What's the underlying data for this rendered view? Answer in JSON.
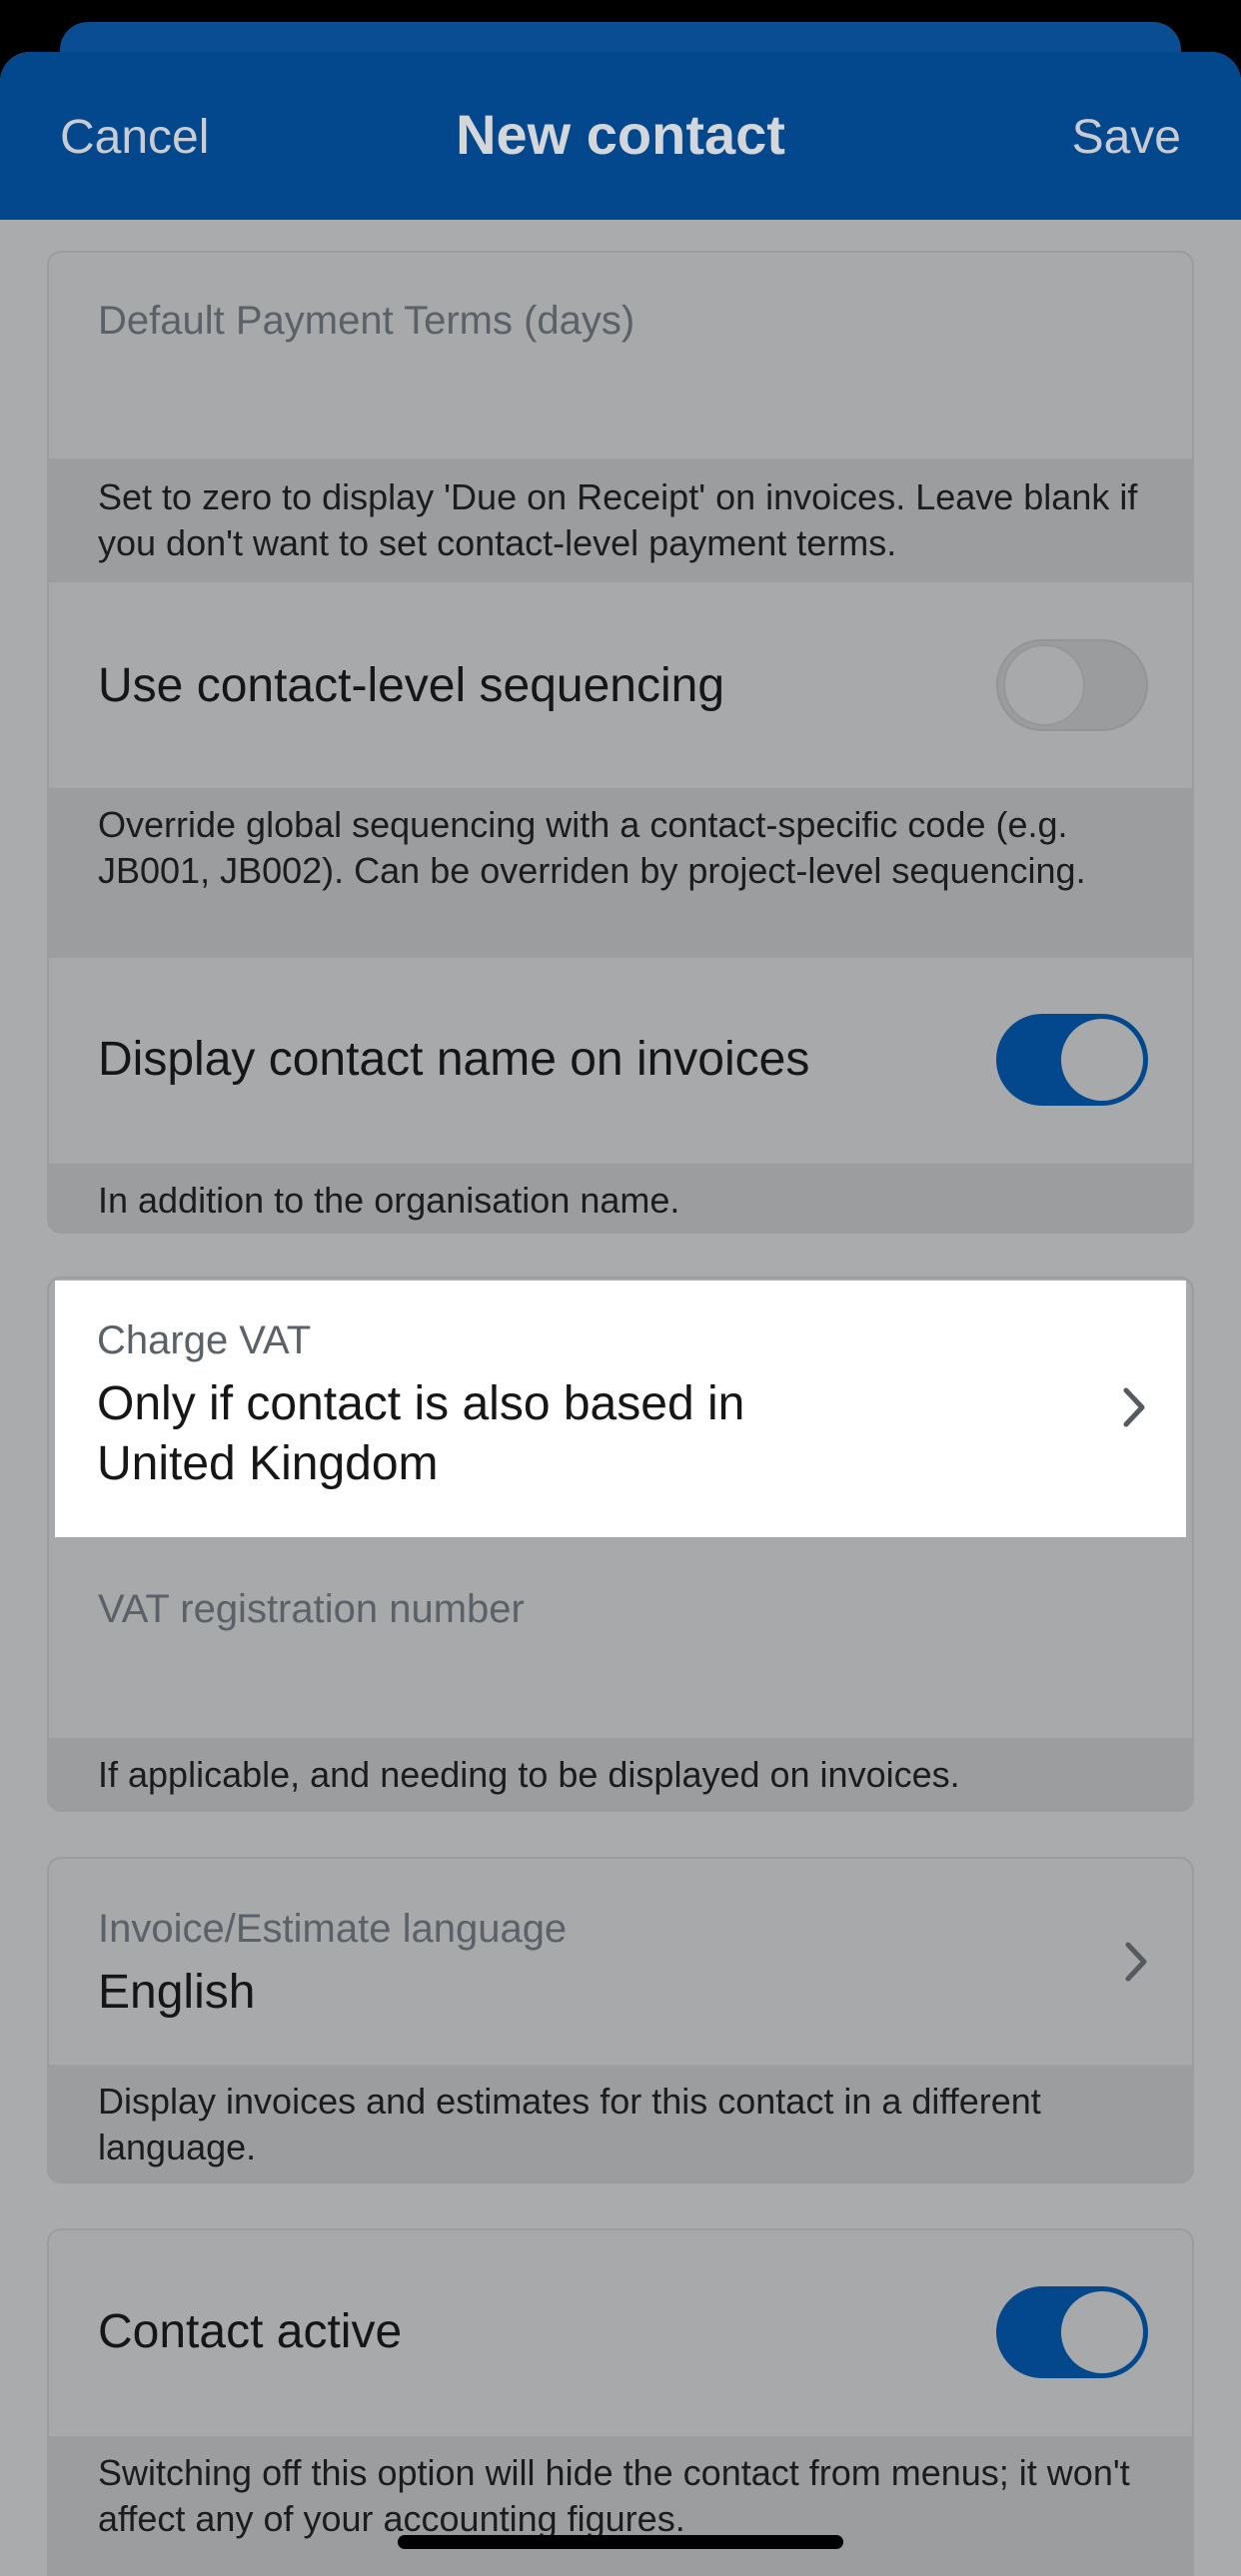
{
  "nav": {
    "cancel": "Cancel",
    "title": "New contact",
    "save": "Save"
  },
  "payment_terms": {
    "label": "Default Payment Terms (days)",
    "help": "Set to zero to display 'Due on Receipt' on invoices. Leave blank if you don't want to set contact-level payment terms."
  },
  "sequencing": {
    "label": "Use contact-level sequencing",
    "enabled": false,
    "help": "Override global sequencing with a contact-specific code (e.g. JB001, JB002). Can be overriden by project-level sequencing."
  },
  "display_name": {
    "label": "Display contact name on invoices",
    "enabled": true,
    "help": "In addition to the organisation name."
  },
  "vat": {
    "charge_label": "Charge VAT",
    "charge_value_line1": "Only if contact is also based in",
    "charge_value_line2": "United Kingdom",
    "reg_label": "VAT registration number",
    "reg_help": "If applicable, and needing to be displayed on invoices."
  },
  "language": {
    "label": "Invoice/Estimate language",
    "value": "English",
    "help": "Display invoices and estimates for this contact in a different language."
  },
  "active": {
    "label": "Contact active",
    "enabled": true,
    "help": "Switching off this option will hide the contact from menus; it won't affect any of your accounting figures."
  },
  "colors": {
    "brand": "#03478c",
    "overlay_bg": "#aaabad",
    "highlight": "#ffffff"
  },
  "icons": [
    "chevron-right-icon"
  ]
}
